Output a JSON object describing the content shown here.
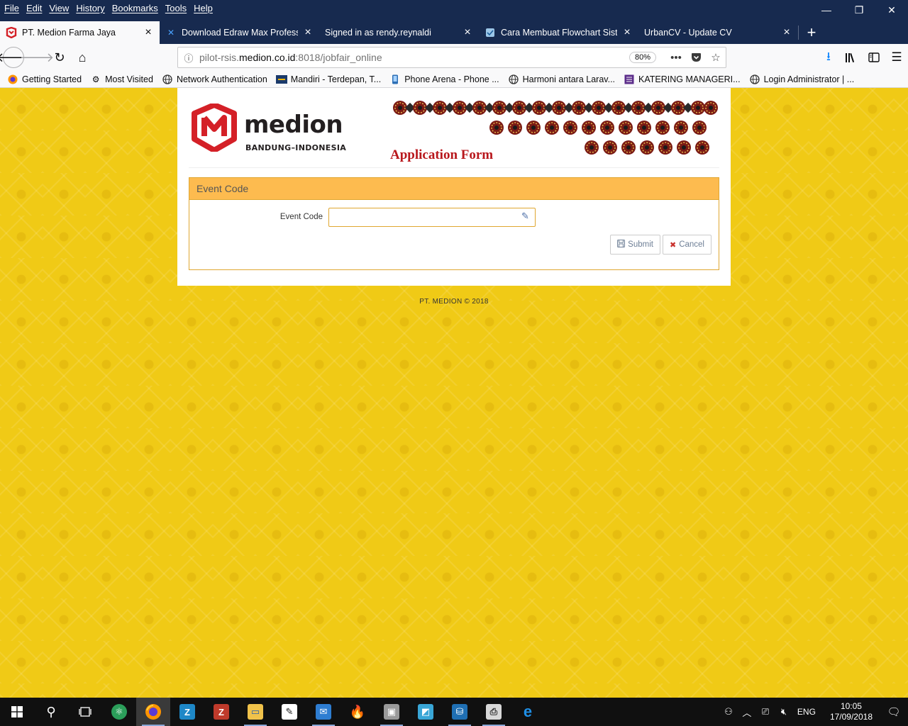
{
  "menu": [
    "File",
    "Edit",
    "View",
    "History",
    "Bookmarks",
    "Tools",
    "Help"
  ],
  "window_controls": {
    "minimize": "—",
    "restore": "❐",
    "close": "✕"
  },
  "tabs": [
    {
      "title": "PT. Medion Farma Jaya",
      "icon": "medion-favicon",
      "active": true
    },
    {
      "title": "Download Edraw Max Professional",
      "icon": "edraw-favicon",
      "active": false
    },
    {
      "title": "Signed in as rendy.reynaldi",
      "icon": "",
      "active": false
    },
    {
      "title": "Cara Membuat Flowchart Sistem",
      "icon": "shield-favicon",
      "active": false
    },
    {
      "title": "UrbanCV - Update CV",
      "icon": "",
      "active": false
    }
  ],
  "new_tab": "+",
  "url": {
    "prefix": "pilot-rsis.",
    "domain": "medion.co.id",
    "suffix": ":8018/jobfair_online"
  },
  "zoom": "80%",
  "bookmarks": [
    {
      "label": "Getting Started",
      "icon": "firefox-icon"
    },
    {
      "label": "Most Visited",
      "icon": "gear-icon"
    },
    {
      "label": "Network Authentication",
      "icon": "globe-icon"
    },
    {
      "label": "Mandiri - Terdepan, T...",
      "icon": "mandiri-icon"
    },
    {
      "label": "Phone Arena - Phone ...",
      "icon": "phone-icon"
    },
    {
      "label": "Harmoni antara Larav...",
      "icon": "globe-icon"
    },
    {
      "label": "KATERING MANAGERI...",
      "icon": "list-icon"
    },
    {
      "label": "Login Administrator | ...",
      "icon": "globe-icon"
    }
  ],
  "page": {
    "logo_brand": "medion",
    "logo_city": "BANDUNG–INDONESIA",
    "banner_title": "Application Form",
    "panel_heading": "Event Code",
    "form": {
      "label": "Event Code",
      "value": "",
      "placeholder": ""
    },
    "submit_label": "Submit",
    "cancel_label": "Cancel",
    "footer": "PT. MEDION © 2018"
  },
  "colors": {
    "background": "#f0ca16",
    "panel_heading": "#fdbb4f",
    "panel_border": "#e0a731",
    "brand_red": "#d42027",
    "titlebar": "#172a4f"
  },
  "tray": {
    "lang": "ENG",
    "time": "10:05",
    "date": "17/09/2018",
    "notifications": "1"
  }
}
